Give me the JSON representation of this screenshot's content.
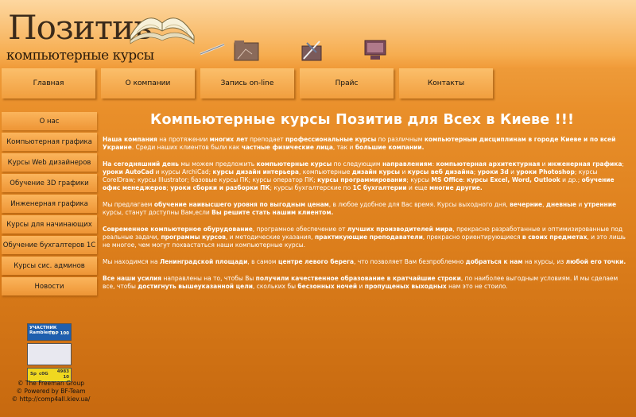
{
  "logo": {
    "title": "Позитив",
    "subtitle": "компьютерные курсы"
  },
  "topnav": [
    "Главная",
    "О компании",
    "Запись on-line",
    "Прайс",
    "Контакты"
  ],
  "sidebar": [
    "О нас",
    "Компьютерная графика",
    "Курсы Web дизайнеров",
    "Обучение 3D графики",
    "Инженерная графика",
    "Курсы для начинающих",
    "Обучение бухгалтеров 1С",
    "Курсы сис. админов",
    "Новости"
  ],
  "heading": "Компьютерные курсы Позитив для Всех в Киеве !!!",
  "paragraphs": [
    [
      {
        "t": "Наша компания",
        "b": true
      },
      {
        "t": " на протяжении "
      },
      {
        "t": "многих лет",
        "b": true
      },
      {
        "t": " преподает "
      },
      {
        "t": "профессиональные курсы",
        "b": true
      },
      {
        "t": " по различным "
      },
      {
        "t": "компьютерным дисциплинам в городе Киеве и по всей Украине",
        "b": true
      },
      {
        "t": ". Среди наших клиентов были как "
      },
      {
        "t": "частные физические лица",
        "b": true
      },
      {
        "t": ", так и "
      },
      {
        "t": "большие компании.",
        "b": true
      }
    ],
    [
      {
        "t": "На сегодняшний день",
        "b": true
      },
      {
        "t": " мы можем предложить "
      },
      {
        "t": "компьютерные курсы",
        "b": true
      },
      {
        "t": " по следующим "
      },
      {
        "t": "направлениям",
        "b": true
      },
      {
        "t": ": "
      },
      {
        "t": "компьютерная архитектурная",
        "b": true
      },
      {
        "t": " и "
      },
      {
        "t": "инженерная графика",
        "b": true
      },
      {
        "t": "; "
      },
      {
        "t": "уроки AutoCad",
        "b": true
      },
      {
        "t": " и курсы ArchiCad; "
      },
      {
        "t": "курсы дизайн интерьера",
        "b": true
      },
      {
        "t": ", компьютерные "
      },
      {
        "t": "дизайн курсы",
        "b": true
      },
      {
        "t": " и "
      },
      {
        "t": "курсы веб дизайна",
        "b": true
      },
      {
        "t": "; "
      },
      {
        "t": "уроки 3d",
        "b": true
      },
      {
        "t": " и "
      },
      {
        "t": "уроки Photoshop",
        "b": true
      },
      {
        "t": "; курсы CorelDraw; курсы Illustrator;  базовые курсы ПК; курсы оператор ПК; "
      },
      {
        "t": "курсы программирования",
        "b": true
      },
      {
        "t": "; курсы "
      },
      {
        "t": "MS Office",
        "b": true
      },
      {
        "t": ": "
      },
      {
        "t": "курсы Excel, Word, Outlook",
        "b": true
      },
      {
        "t": " и др.; "
      },
      {
        "t": "обучение офис менеджеров",
        "b": true
      },
      {
        "t": "; "
      },
      {
        "t": "уроки сборки и разборки ПК",
        "b": true
      },
      {
        "t": "; курсы бухгалтерские по "
      },
      {
        "t": "1С бухгалтерии",
        "b": true
      },
      {
        "t": " и еще "
      },
      {
        "t": "многие другие.",
        "b": true
      }
    ],
    [
      {
        "t": "Мы предлагаем "
      },
      {
        "t": "обучение наивысшего уровня по выгодным ценам",
        "b": true
      },
      {
        "t": ", в любое удобное для Вас время. Курсы выходного дня, "
      },
      {
        "t": "вечерние",
        "b": true
      },
      {
        "t": ", "
      },
      {
        "t": "дневные",
        "b": true
      },
      {
        "t": " и "
      },
      {
        "t": "утренние",
        "b": true
      },
      {
        "t": " курсы, станут доступны Вам,если "
      },
      {
        "t": "Вы решите стать нашим клиентом.",
        "b": true
      }
    ],
    [
      {
        "t": "Современное компьютерное обурудование",
        "b": true
      },
      {
        "t": ", програмное обеспечение от "
      },
      {
        "t": "лучших производителей мира",
        "b": true
      },
      {
        "t": ", прекрасно разработанные и оптимизированные под реальные задачи, "
      },
      {
        "t": "программы курсов",
        "b": true
      },
      {
        "t": ", и методические указания, "
      },
      {
        "t": "практикующие преподаватели",
        "b": true
      },
      {
        "t": ", прекрасно ориентирующиеся "
      },
      {
        "t": "в своих предметах",
        "b": true
      },
      {
        "t": ", и это лишь не многое, чем могут похвастаться наши компьютерные курсы."
      }
    ],
    [
      {
        "t": "Мы находимся на "
      },
      {
        "t": "Ленинградской площади",
        "b": true
      },
      {
        "t": ", в самом "
      },
      {
        "t": "центре левого берега",
        "b": true
      },
      {
        "t": ", что позволяет Вам безпроблемно "
      },
      {
        "t": "добраться к нам",
        "b": true
      },
      {
        "t": " на курсы, из "
      },
      {
        "t": "любой его точки.",
        "b": true
      }
    ],
    [
      {
        "t": "Все наши усилия",
        "b": true
      },
      {
        "t": " направлены на то, чтобы Вы "
      },
      {
        "t": "получили качественное образование в кратчайшие строки",
        "b": true
      },
      {
        "t": ", по наиболее выгодным условиям. И мы сделаем все, чтобы "
      },
      {
        "t": "достигнуть вышеуказанной цели",
        "b": true
      },
      {
        "t": ", скольких бы "
      },
      {
        "t": "бесзонных ночей",
        "b": true
      },
      {
        "t": " и "
      },
      {
        "t": "пропущеных выходных",
        "b": true
      },
      {
        "t": " нам это не стоило."
      }
    ]
  ],
  "badges": {
    "rambler_label": "УЧАСТНИК Rambler's",
    "rambler_top": "TOP 100",
    "counter_top": "4983",
    "counter_bottom": "10",
    "counter_label": "Sp",
    "counter_line2": "с0G"
  },
  "footer": [
    "© The Freeman Group",
    "© Powered by BF-Team",
    "© http://comp4all.kiev.ua/"
  ],
  "colors": {
    "background": "#e98f2a",
    "tab": "#f5a94e",
    "text": "#ffffff"
  }
}
